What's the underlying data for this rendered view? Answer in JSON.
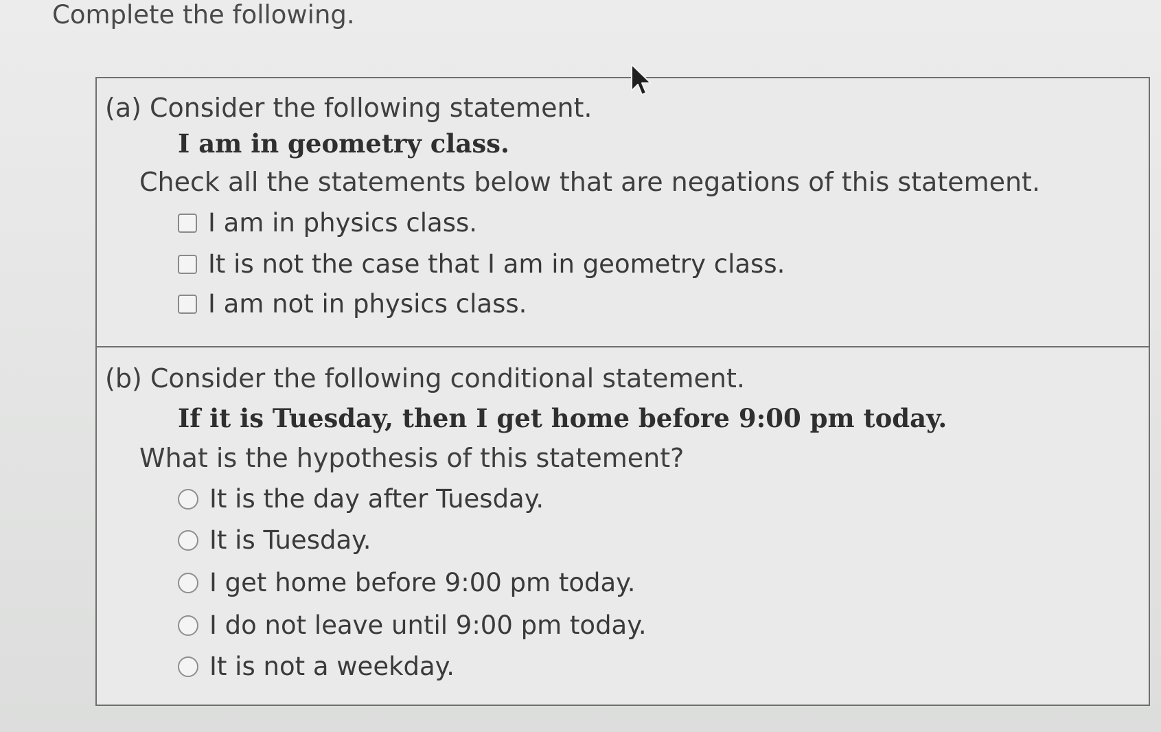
{
  "instruction": "Complete the following.",
  "part_a": {
    "title": "(a) Consider the following statement.",
    "statement": "I am in geometry class.",
    "prompt": "Check all the statements below that are negations of this statement.",
    "options": [
      {
        "label": "I am in physics class.",
        "checked": false
      },
      {
        "label": "It is not the case that I am in geometry class.",
        "checked": false
      },
      {
        "label": "I am not in physics class.",
        "checked": false
      }
    ]
  },
  "part_b": {
    "title": "(b) Consider the following conditional statement.",
    "statement": "If it is Tuesday, then I get home before 9:00 pm today.",
    "prompt": "What is the hypothesis of this statement?",
    "options": [
      {
        "label": "It is the day after Tuesday.",
        "selected": false
      },
      {
        "label": "It is Tuesday.",
        "selected": false
      },
      {
        "label": "I get home before 9:00 pm today.",
        "selected": false
      },
      {
        "label": "I do not leave until 9:00 pm today.",
        "selected": false
      },
      {
        "label": "It is not a weekday.",
        "selected": false
      }
    ]
  },
  "cursor_icon": "mouse-pointer-icon"
}
